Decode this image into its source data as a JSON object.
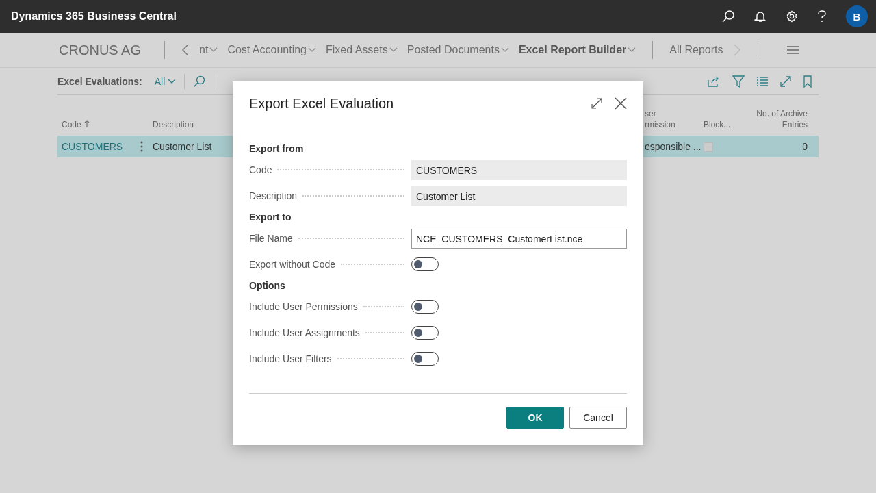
{
  "app_bar": {
    "title": "Dynamics 365 Business Central",
    "avatar": "B"
  },
  "nav": {
    "company": "CRONUS AG",
    "items": [
      {
        "label": "nt",
        "selected": false
      },
      {
        "label": "Cost Accounting",
        "selected": false
      },
      {
        "label": "Fixed Assets",
        "selected": false
      },
      {
        "label": "Posted Documents",
        "selected": false
      },
      {
        "label": "Excel Report Builder",
        "selected": true
      }
    ],
    "end_item": "All Reports"
  },
  "toolbar": {
    "filter_label": "Excel Evaluations:",
    "filter_value": "All"
  },
  "table": {
    "columns": [
      {
        "label": "Code",
        "sorted": true
      },
      {
        "label": "Description",
        "sorted": false
      },
      {
        "label": "ser\nrmission",
        "sorted": false
      },
      {
        "label": "Block...",
        "sorted": false
      },
      {
        "label": "No. of Archive\nEntries",
        "sorted": false
      }
    ],
    "rows": [
      {
        "selected": true,
        "code": "CUSTOMERS",
        "description": "Customer List",
        "column_4": "esponsible ...",
        "blocked": false,
        "archive_entries": "0"
      }
    ]
  },
  "dialog": {
    "title": "Export Excel Evaluation",
    "sections": [
      {
        "heading": "Export from",
        "fields": [
          {
            "kind": "text",
            "label": "Code",
            "value": "CUSTOMERS",
            "editable": false
          },
          {
            "kind": "text",
            "label": "Description",
            "value": "Customer List",
            "editable": false
          }
        ]
      },
      {
        "heading": "Export to",
        "fields": [
          {
            "kind": "text",
            "label": "File Name",
            "value": "NCE_CUSTOMERS_CustomerList.nce",
            "editable": true
          },
          {
            "kind": "toggle",
            "label": "Export without Code",
            "on": false
          }
        ]
      },
      {
        "heading": "Options",
        "fields": [
          {
            "kind": "toggle",
            "label": "Include User Permissions",
            "on": false
          },
          {
            "kind": "toggle",
            "label": "Include User Assignments",
            "on": false
          },
          {
            "kind": "toggle",
            "label": "Include User Filters",
            "on": false
          }
        ]
      }
    ],
    "buttons": [
      {
        "label": "OK",
        "primary": true
      },
      {
        "label": "Cancel",
        "primary": false
      }
    ]
  }
}
